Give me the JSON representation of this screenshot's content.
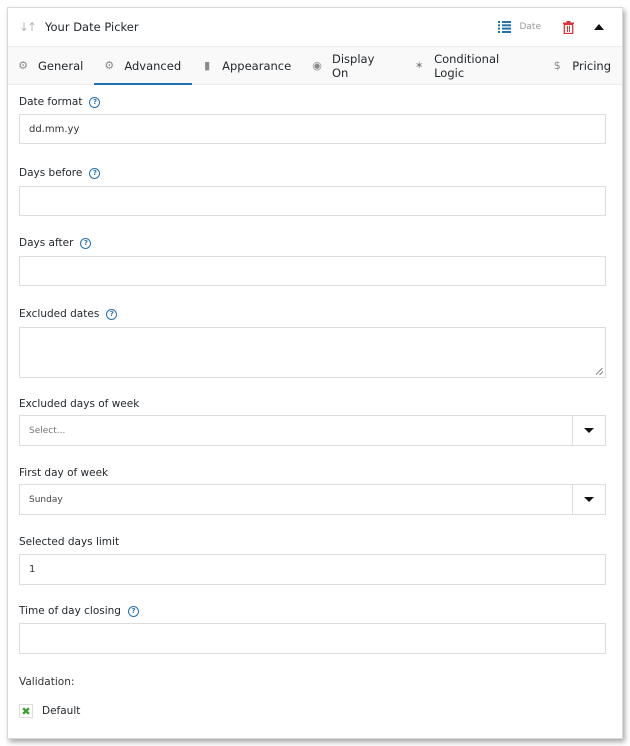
{
  "header": {
    "title": "Your Date Picker",
    "type_label": "Date",
    "icons": {
      "drag": "sort-arrows-icon",
      "list": "list-icon",
      "delete": "trash-icon",
      "collapse": "caret-up-icon"
    }
  },
  "tabs": [
    {
      "label": "General",
      "icon": "gear-icon",
      "glyph": "⚙",
      "active": false
    },
    {
      "label": "Advanced",
      "icon": "gears-icon",
      "glyph": "⚙",
      "active": true
    },
    {
      "label": "Appearance",
      "icon": "brush-icon",
      "glyph": "▮",
      "active": false
    },
    {
      "label": "Display On",
      "icon": "eye-icon",
      "glyph": "◉",
      "active": false
    },
    {
      "label": "Conditional Logic",
      "icon": "magic-wand-icon",
      "glyph": "✶",
      "active": false
    },
    {
      "label": "Pricing",
      "icon": "dollar-icon",
      "glyph": "$",
      "active": false
    }
  ],
  "fields": {
    "date_format": {
      "label": "Date format",
      "value": "dd.mm.yy"
    },
    "days_before": {
      "label": "Days before",
      "value": ""
    },
    "days_after": {
      "label": "Days after",
      "value": ""
    },
    "excluded_dates": {
      "label": "Excluded dates",
      "value": ""
    },
    "excluded_days_of_week": {
      "label": "Excluded days of week",
      "placeholder": "Select..."
    },
    "first_day_of_week": {
      "label": "First day of week",
      "value": "Sunday"
    },
    "selected_days_limit": {
      "label": "Selected days limit",
      "value": "1"
    },
    "time_of_day_closing": {
      "label": "Time of day closing",
      "value": ""
    }
  },
  "validation": {
    "label": "Validation:",
    "options": [
      {
        "label": "Default",
        "checked": true
      }
    ]
  },
  "help_glyph": "?",
  "colors": {
    "accent": "#2271b1",
    "delete": "#d63638",
    "check": "#3a9b2e"
  }
}
